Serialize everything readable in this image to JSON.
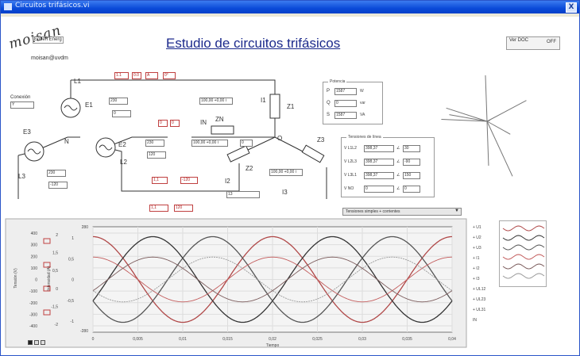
{
  "window": {
    "title": "Circuitos trifásicos.vi",
    "close_label": "X"
  },
  "page_title": "Estudio de circuitos trifásicos",
  "logo": {
    "script": "moisan",
    "badge_text": "Enseñ\nEnerg",
    "email": "moisan@uvdm"
  },
  "top_button_label": "Ver DOC",
  "top_button_toggle": "OFF",
  "left_label": "Conexión",
  "left_value": "Y",
  "circuit": {
    "source_e1": "E1",
    "source_e2": "E2",
    "source_e3": "E3",
    "nodes": [
      "L1",
      "L2",
      "L3",
      "N",
      "O"
    ],
    "impedances": [
      "Z1",
      "Z2",
      "Z3",
      "ZN"
    ],
    "currents": [
      "I1",
      "I2",
      "I3",
      "IN"
    ],
    "fields": [
      {
        "text": "1.1",
        "red": true
      },
      {
        "text": "0.0",
        "red": true
      },
      {
        "text": "A",
        "red": true
      },
      {
        "text": "0°",
        "red": true
      },
      {
        "text": "230",
        "red": false
      },
      {
        "text": "0",
        "red": false
      },
      {
        "text": "100,00 +0,00 i",
        "red": false
      },
      {
        "text": "0",
        "red": true
      },
      {
        "text": "0",
        "red": true
      },
      {
        "text": "230",
        "red": false
      },
      {
        "text": "120",
        "red": false
      },
      {
        "text": "100,00 +0,00 i",
        "red": false
      },
      {
        "text": "0",
        "red": false
      },
      {
        "text": "1,1",
        "red": true
      },
      {
        "text": "-120",
        "red": true
      },
      {
        "text": "100,00 +0,00 i",
        "red": false
      },
      {
        "text": "230",
        "red": false
      },
      {
        "text": "-120",
        "red": false
      },
      {
        "text": "1,1",
        "red": true
      },
      {
        "text": "120",
        "red": true
      },
      {
        "text": "13",
        "red": false
      }
    ]
  },
  "potencia": {
    "title": "Potencia",
    "rows": [
      {
        "label": "P",
        "value": "1587",
        "unit": "W"
      },
      {
        "label": "Q",
        "value": "0",
        "unit": "var"
      },
      {
        "label": "S",
        "value": "1587",
        "unit": "VA"
      }
    ]
  },
  "tensiones": {
    "title": "Tensiones de línea",
    "rows": [
      {
        "label": "V L1L2",
        "value": "398,37",
        "angle": "30"
      },
      {
        "label": "V L2L3",
        "value": "398,37",
        "angle": "-90"
      },
      {
        "label": "V L3L1",
        "value": "398,37",
        "angle": "150"
      },
      {
        "label": "V NO",
        "value": "0",
        "angle": "0"
      }
    ]
  },
  "dropdown_label": "Tensiones simples + corrientes",
  "legend": {
    "items": [
      "+ U1",
      "+ U2",
      "+ U3",
      "+ I1",
      "+ I2",
      "+ I3",
      "+ UL12",
      "+ UL23",
      "+ UL31",
      "IN"
    ]
  },
  "plot_labels": {
    "y_left_title": "Tensión (V)",
    "y_right_title": "Intensidad (A)",
    "x_title": "Tiempo",
    "y_left_ticks": [
      "400",
      "300",
      "200",
      "100",
      "0",
      "-100",
      "-200",
      "-300",
      "-400"
    ],
    "y_right_ticks": [
      "1",
      "0,5",
      "0",
      "-0,5",
      "-1"
    ],
    "y_mid_ticks": [
      "2",
      "1,5",
      "0,5",
      "0",
      "-1,5",
      "-2"
    ],
    "top_tick": "280",
    "bottom_tick": "-280",
    "x_ticks": [
      "0",
      "0,005",
      "0,01",
      "0,015",
      "0,02",
      "0,025",
      "0,03",
      "0,035",
      "0,04"
    ]
  },
  "chart_data": {
    "type": "line",
    "xlabel": "Tiempo",
    "ylabel": "Tensión (V)",
    "x_range": [
      0,
      0.04
    ],
    "y_range": [
      -400,
      400
    ],
    "grid": true,
    "series": [
      {
        "name": "U1",
        "amplitude": 325,
        "phase_deg": 0,
        "color": "#b04848"
      },
      {
        "name": "U2",
        "amplitude": 325,
        "phase_deg": -120,
        "color": "#333333"
      },
      {
        "name": "U3",
        "amplitude": 325,
        "phase_deg": 120,
        "color": "#555555"
      },
      {
        "name": "I1",
        "amplitude": 170,
        "phase_deg": 0,
        "color": "#c25a5a"
      },
      {
        "name": "I2",
        "amplitude": 170,
        "phase_deg": -120,
        "color": "#7a5a5a"
      },
      {
        "name": "I3",
        "amplitude": 170,
        "phase_deg": 120,
        "color": "#999999"
      }
    ],
    "frequency_hz": 50
  },
  "colors": {
    "title_bar": "#0a4ad8",
    "heading": "#1c2a8c",
    "wave_red": "#b04848",
    "plot_bg": "#f4f4f4"
  }
}
